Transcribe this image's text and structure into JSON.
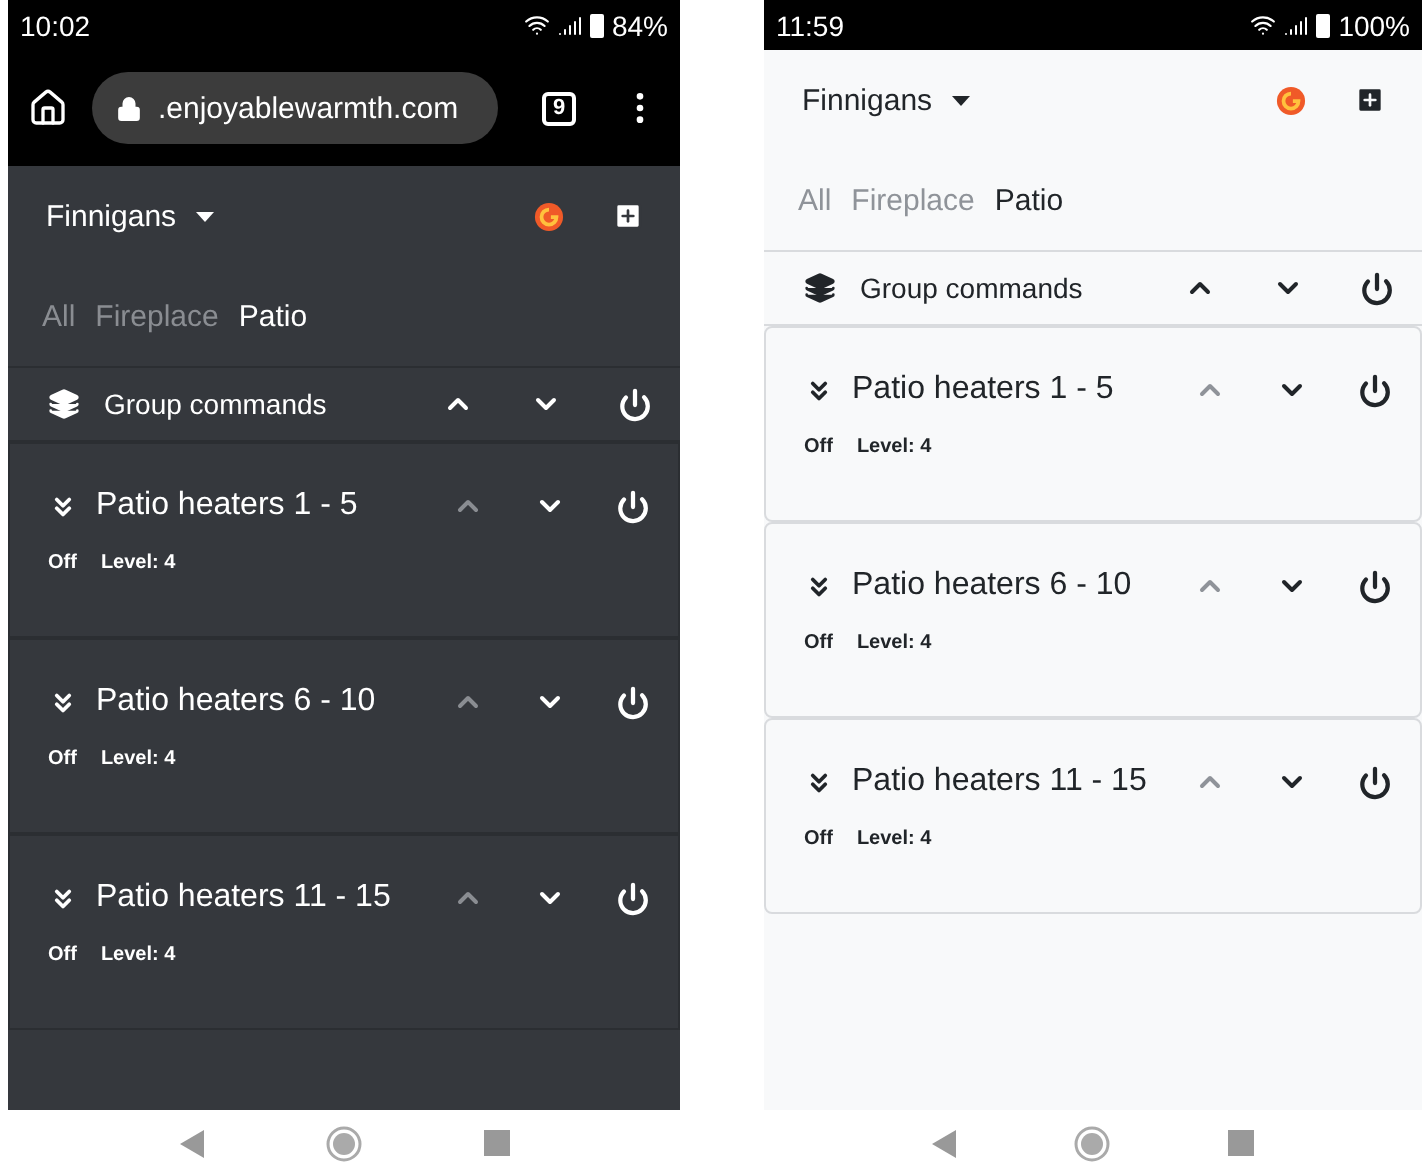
{
  "phones": [
    {
      "kind": "dark",
      "status_bar": {
        "time": "10:02",
        "battery": "84%"
      },
      "browser_bar": {
        "url": ".enjoyablewarmth.com",
        "tab_count": "9"
      },
      "location": "Finnigans",
      "tabs": [
        {
          "label": "All",
          "selected": false
        },
        {
          "label": "Fireplace",
          "selected": false
        },
        {
          "label": "Patio",
          "selected": true
        }
      ],
      "group_commands": {
        "label": "Group commands",
        "up_disabled": false
      },
      "heaters": [
        {
          "name": "Patio heaters 1 - 5",
          "status": "Off",
          "level": "Level: 4",
          "up_disabled": true
        },
        {
          "name": "Patio heaters 6 - 10",
          "status": "Off",
          "level": "Level: 4",
          "up_disabled": true
        },
        {
          "name": "Patio heaters 11 - 15",
          "status": "Off",
          "level": "Level: 4",
          "up_disabled": true
        }
      ]
    },
    {
      "kind": "light",
      "status_bar": {
        "time": "11:59",
        "battery": "100%"
      },
      "location": "Finnigans",
      "tabs": [
        {
          "label": "All",
          "selected": false
        },
        {
          "label": "Fireplace",
          "selected": false
        },
        {
          "label": "Patio",
          "selected": true
        }
      ],
      "group_commands": {
        "label": "Group commands",
        "up_disabled": false
      },
      "heaters": [
        {
          "name": "Patio heaters 1 - 5",
          "status": "Off",
          "level": "Level: 4",
          "up_disabled": true
        },
        {
          "name": "Patio heaters 6 - 10",
          "status": "Off",
          "level": "Level: 4",
          "up_disabled": true
        },
        {
          "name": "Patio heaters 11 - 15",
          "status": "Off",
          "level": "Level: 4",
          "up_disabled": true
        }
      ]
    }
  ]
}
